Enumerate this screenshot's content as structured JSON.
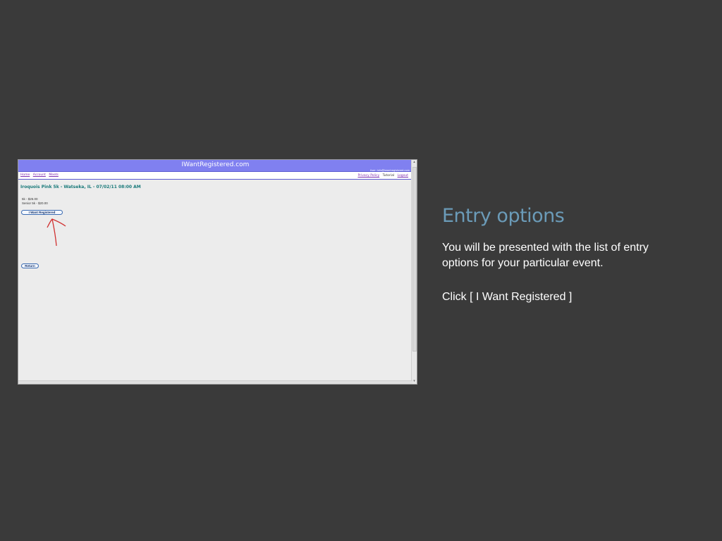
{
  "slide": {
    "title": "Entry options",
    "paragraph1": "You will be presented with the list of entry options for your particular event.",
    "paragraph2": "Click [ I Want Registered ]"
  },
  "screenshot": {
    "site_title": "IWantRegistered.com",
    "user_line": "User: info@iwantregistered.com",
    "nav_left": [
      "Home",
      "Account",
      "Meets"
    ],
    "nav_right": [
      "Privacy Policy",
      "Tutorial",
      "Logout"
    ],
    "event_title": "Iroquois Pink 5k  -  Watseka, IL  -  07/02/11 08:00 AM",
    "entries": [
      "5k - $25.00",
      "Senior 5k - $20.00"
    ],
    "register_button": "I Want Registered",
    "return_button": "Return"
  },
  "icons": {
    "annotation": "red-arrow-icon"
  },
  "colors": {
    "background": "#3a3a3a",
    "title": "#6b9bb8",
    "header": "#8080f0",
    "arrow": "#d03030"
  }
}
